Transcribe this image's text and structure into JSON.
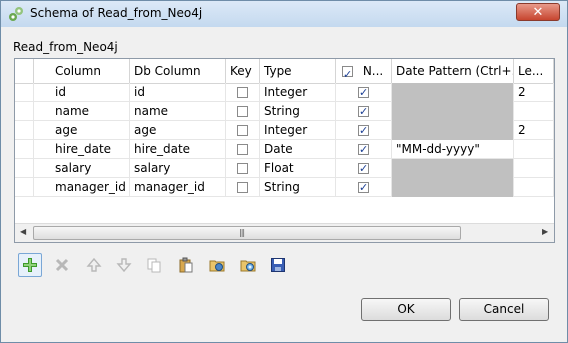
{
  "window": {
    "title": "Schema of Read_from_Neo4j"
  },
  "schema_label": "Read_from_Neo4j",
  "table": {
    "columns": [
      "Column",
      "Db Column",
      "Key",
      "Type",
      "N...",
      "Date Pattern (Ctrl+...",
      "Le..."
    ],
    "rows": [
      {
        "column": "id",
        "db_column": "id",
        "key": false,
        "type": "Integer",
        "nullable": true,
        "date_pattern": "",
        "length": "2"
      },
      {
        "column": "name",
        "db_column": "name",
        "key": false,
        "type": "String",
        "nullable": true,
        "date_pattern": "",
        "length": ""
      },
      {
        "column": "age",
        "db_column": "age",
        "key": false,
        "type": "Integer",
        "nullable": true,
        "date_pattern": "",
        "length": "2"
      },
      {
        "column": "hire_date",
        "db_column": "hire_date",
        "key": false,
        "type": "Date",
        "nullable": true,
        "date_pattern": "\"MM-dd-yyyy\"",
        "length": ""
      },
      {
        "column": "salary",
        "db_column": "salary",
        "key": false,
        "type": "Float",
        "nullable": true,
        "date_pattern": "",
        "length": ""
      },
      {
        "column": "manager_id",
        "db_column": "manager_id",
        "key": false,
        "type": "String",
        "nullable": true,
        "date_pattern": "",
        "length": ""
      }
    ]
  },
  "toolbar": {
    "buttons": [
      {
        "icon": "add-icon"
      },
      {
        "icon": "delete-icon"
      },
      {
        "icon": "move-up-icon"
      },
      {
        "icon": "move-down-icon"
      },
      {
        "icon": "copy-icon"
      },
      {
        "icon": "paste-icon"
      },
      {
        "icon": "import-schema-icon"
      },
      {
        "icon": "export-schema-icon"
      },
      {
        "icon": "save-icon"
      }
    ]
  },
  "buttons": {
    "ok": "OK",
    "cancel": "Cancel"
  },
  "colors": {
    "title_gradient_top": "#dce9f7",
    "title_gradient_bottom": "#c4d9ef",
    "close_red": "#c7452f",
    "disabled_cell": "#c0c0c0",
    "check_blue": "#1c3f94"
  }
}
